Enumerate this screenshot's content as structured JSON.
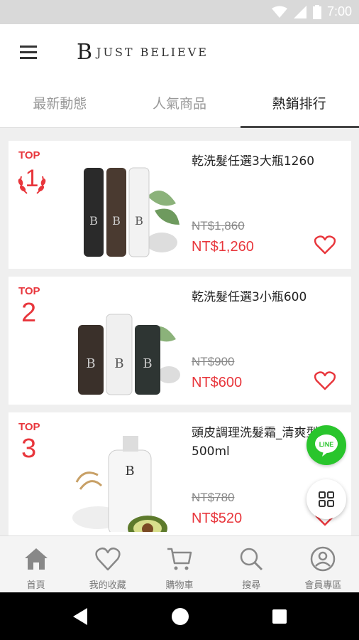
{
  "status": {
    "time": "7:00"
  },
  "header": {
    "logo_mark": "B",
    "logo_text": "JUST BELIEVE"
  },
  "tabs": [
    {
      "label": "最新動態",
      "active": false
    },
    {
      "label": "人氣商品",
      "active": false
    },
    {
      "label": "熱銷排行",
      "active": true
    }
  ],
  "products": [
    {
      "top": "TOP",
      "rank": "1",
      "name": "乾洗髮任選3大瓶1260",
      "old_price": "NT$1,860",
      "price": "NT$1,260"
    },
    {
      "top": "TOP",
      "rank": "2",
      "name": "乾洗髮任選3小瓶600",
      "old_price": "NT$900",
      "price": "NT$600"
    },
    {
      "top": "TOP",
      "rank": "3",
      "name": "頭皮調理洗髮霜_清爽型500ml",
      "old_price": "NT$780",
      "price": "NT$520"
    }
  ],
  "fab": {
    "line_label": "LINE"
  },
  "bottom_nav": [
    {
      "label": "首頁",
      "icon": "home-icon"
    },
    {
      "label": "我的收藏",
      "icon": "heart-icon"
    },
    {
      "label": "購物車",
      "icon": "cart-icon"
    },
    {
      "label": "搜尋",
      "icon": "search-icon"
    },
    {
      "label": "會員專區",
      "icon": "user-icon"
    }
  ],
  "colors": {
    "accent": "#e8363c",
    "line_green": "#29c52c"
  }
}
